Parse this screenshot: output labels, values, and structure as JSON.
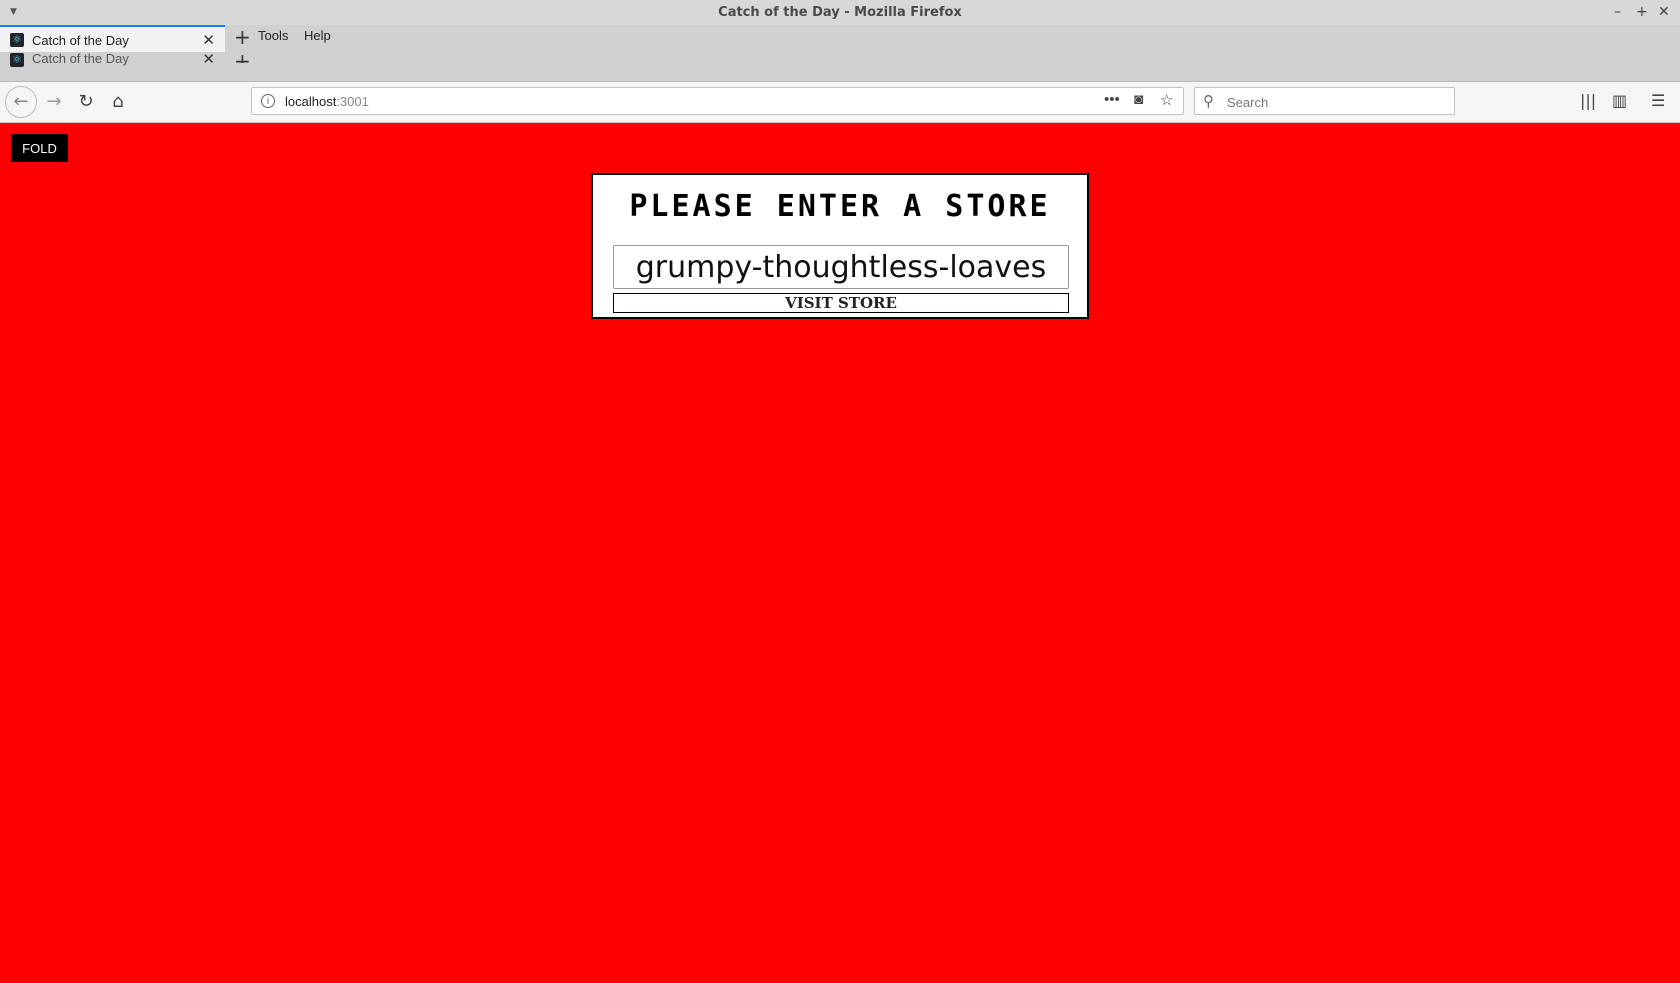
{
  "window": {
    "title": "Catch of the Day - Mozilla Firefox"
  },
  "tabs": [
    {
      "label": "Catch of the Day",
      "favicon": "react-atom-icon"
    },
    {
      "label": "Catch of the Day",
      "favicon": "react-atom-icon"
    }
  ],
  "menubar": {
    "tools": "Tools",
    "help": "Help"
  },
  "navbar": {
    "url_host": "localhost",
    "url_port": ":3001",
    "search_placeholder": "Search"
  },
  "page": {
    "fold_label": "FOLD",
    "heading": "Please Enter A Store",
    "store_input_value": "grumpy-thoughtless-loaves",
    "visit_label": "VISIT STORE",
    "background_color": "#ff0000"
  }
}
